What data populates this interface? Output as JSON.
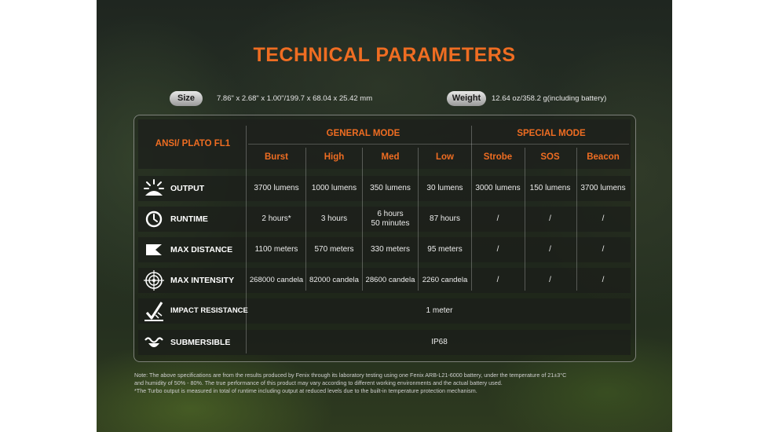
{
  "title": "TECHNICAL PARAMETERS",
  "size": {
    "label": "Size",
    "value": "7.86\" x 2.68\" x 1.00\"/199.7 x 68.04 x 25.42 mm"
  },
  "weight": {
    "label": "Weight",
    "value": "12.64 oz/358.2 g(including battery)"
  },
  "table": {
    "standard": "ANSI/ PLATO  FL1",
    "groups": [
      "GENERAL MODE",
      "SPECIAL MODE"
    ],
    "modes": [
      "Burst",
      "High",
      "Med",
      "Low",
      "Strobe",
      "SOS",
      "Beacon"
    ],
    "rows": [
      {
        "label": "OUTPUT",
        "icon": "burst-light-icon",
        "cells": [
          "3700 lumens",
          "1000 lumens",
          "350 lumens",
          "30 lumens",
          "3000 lumens",
          "150 lumens",
          "3700 lumens"
        ]
      },
      {
        "label": "RUNTIME",
        "icon": "clock-icon",
        "cells": [
          "2 hours*",
          "3 hours",
          "6 hours\n50 minutes",
          "87 hours",
          "/",
          "/",
          "/"
        ]
      },
      {
        "label": "MAX DISTANCE",
        "icon": "beam-distance-icon",
        "cells": [
          "1100 meters",
          "570 meters",
          "330 meters",
          "95 meters",
          "/",
          "/",
          "/"
        ]
      },
      {
        "label": "MAX INTENSITY",
        "icon": "target-icon",
        "cells": [
          "268000 candela",
          "82000 candela",
          "28600 candela",
          "2260 candela",
          "/",
          "/",
          "/"
        ]
      },
      {
        "label": "IMPACT RESISTANCE",
        "icon": "impact-check-icon",
        "span_value": "1 meter"
      },
      {
        "label": "SUBMERSIBLE",
        "icon": "water-splash-icon",
        "span_value": "IP68"
      }
    ]
  },
  "notes": [
    "Note: The above specifications are from the results produced by Fenix through its laboratory testing using one Fenix ARB-L21-6000 battery, under the temperature of 21±3°C",
    "and humidity of 50% - 80%. The true performance of this product may vary according to different working environments and the actual battery used.",
    "*The Turbo output is measured in total of runtime including output at reduced levels due to the built-in temperature protection mechanism."
  ],
  "colors": {
    "accent": "#ef6d22",
    "text": "#ffffff"
  }
}
